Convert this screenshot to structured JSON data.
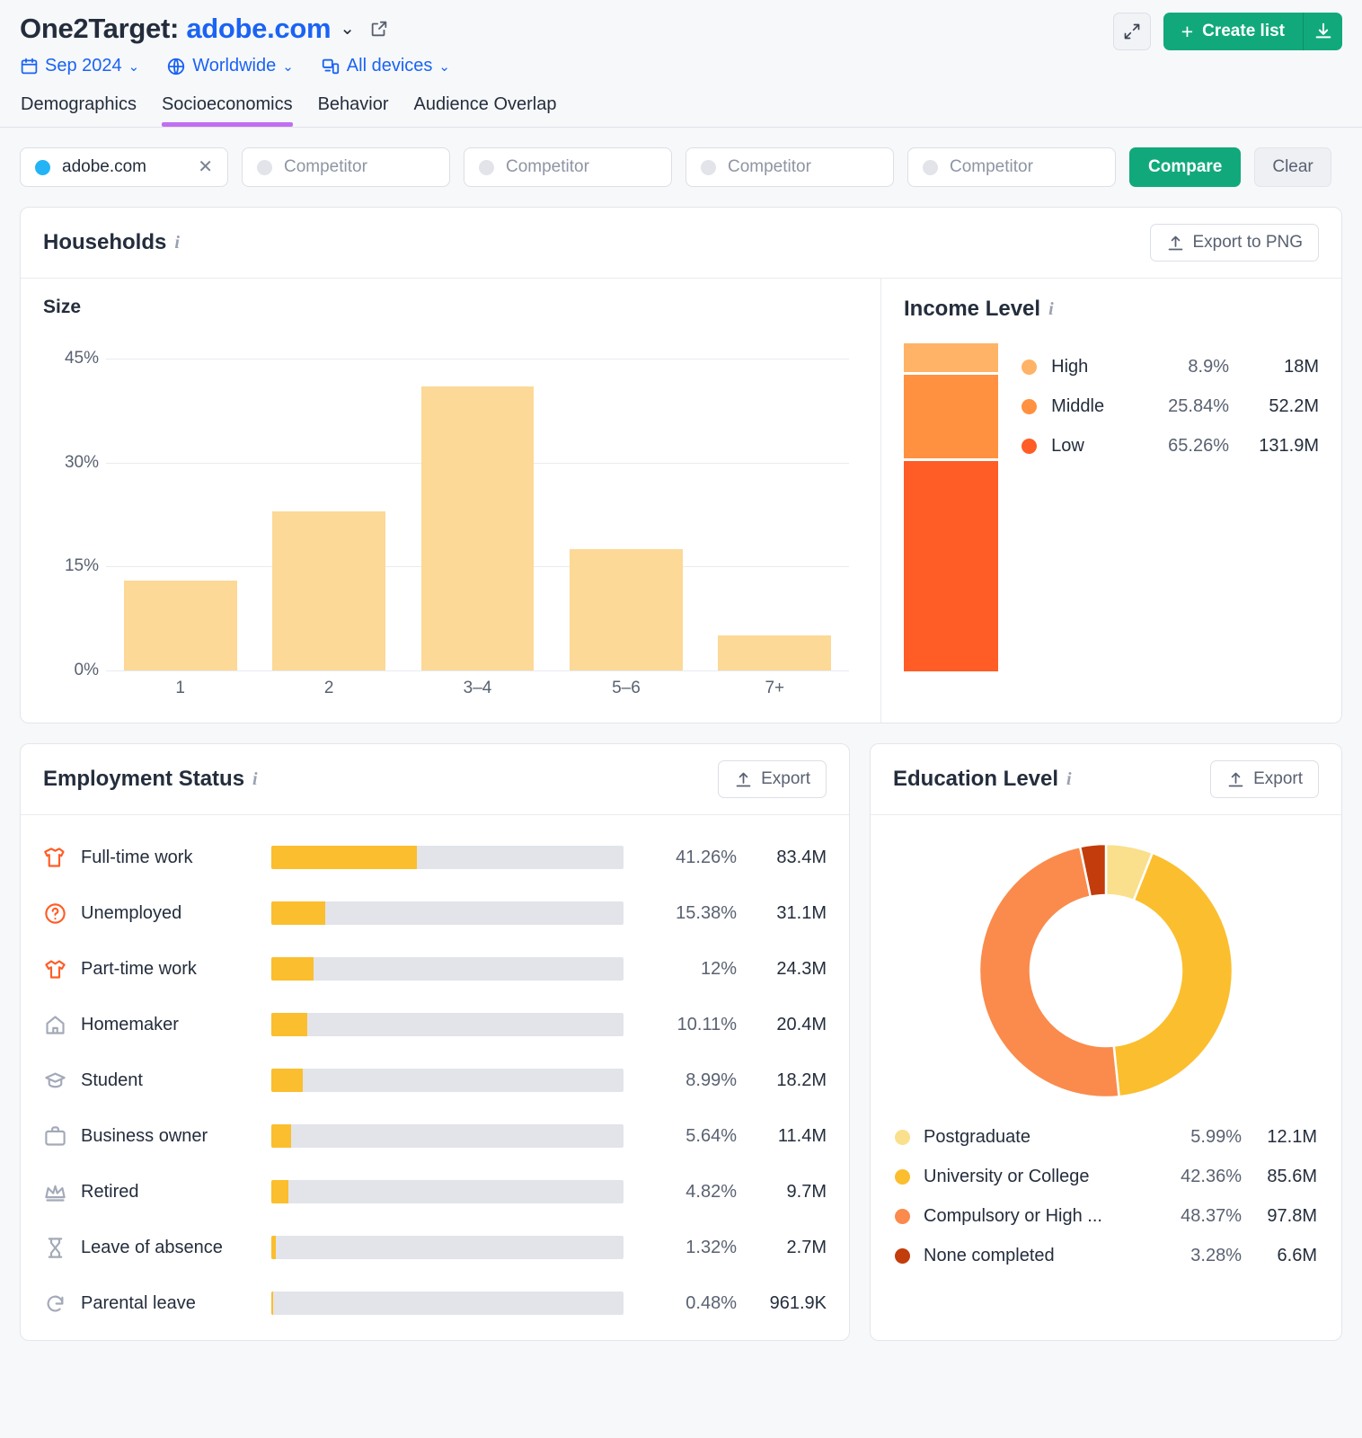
{
  "header": {
    "title_prefix": "One2Target:",
    "domain": "adobe.com",
    "caret": "⌄",
    "expand_icon": "expand-icon",
    "create_list_label": "Create list",
    "create_plus": "+",
    "download_icon": "download-icon",
    "filters": [
      {
        "label": "Sep 2024",
        "icon": "calendar-icon",
        "caret": "⌄"
      },
      {
        "label": "Worldwide",
        "icon": "globe-icon",
        "caret": "⌄"
      },
      {
        "label": "All devices",
        "icon": "devices-icon",
        "caret": "⌄"
      }
    ],
    "tabs": [
      {
        "label": "Demographics",
        "active": false
      },
      {
        "label": "Socioeconomics",
        "active": true
      },
      {
        "label": "Behavior",
        "active": false
      },
      {
        "label": "Audience Overlap",
        "active": false
      }
    ],
    "active_tab_color": "#c06ff2"
  },
  "competitors": {
    "main": {
      "label": "adobe.com",
      "dot_color": "#24b3f5",
      "remove": "✕"
    },
    "placeholders": [
      "Competitor",
      "Competitor",
      "Competitor",
      "Competitor"
    ],
    "compare_label": "Compare",
    "clear_label": "Clear"
  },
  "households": {
    "title": "Households",
    "info": "i",
    "export_label": "Export to PNG",
    "size_title": "Size",
    "income_title": "Income Level",
    "income_info": "i"
  },
  "employment": {
    "title": "Employment Status",
    "info": "i",
    "export_label": "Export"
  },
  "education": {
    "title": "Education Level",
    "info": "i",
    "export_label": "Export"
  },
  "chart_data": [
    {
      "type": "bar",
      "title": "Size",
      "categories": [
        "1",
        "2",
        "3–4",
        "5–6",
        "7+"
      ],
      "values": [
        13.0,
        23.0,
        41.0,
        17.5,
        5.0
      ],
      "ytick_labels": [
        "0%",
        "15%",
        "30%",
        "45%"
      ],
      "yticks": [
        0,
        15,
        30,
        45
      ],
      "ylim": [
        0,
        48
      ],
      "xlabel": "",
      "ylabel": "",
      "grid": true,
      "bar_color": "#fcd997"
    },
    {
      "type": "bar",
      "title": "Income Level",
      "orientation": "stacked-vertical",
      "categories": [
        "High",
        "Middle",
        "Low"
      ],
      "values": [
        8.9,
        25.84,
        65.26
      ],
      "value_labels": [
        "8.9%",
        "25.84%",
        "65.26%"
      ],
      "counts": [
        "18M",
        "52.2M",
        "131.9M"
      ],
      "colors": [
        "#ffb366",
        "#ff9140",
        "#ff5c26"
      ],
      "legend": "right"
    },
    {
      "type": "bar",
      "title": "Employment Status",
      "orientation": "horizontal",
      "categories": [
        "Full-time work",
        "Unemployed",
        "Part-time work",
        "Homemaker",
        "Student",
        "Business owner",
        "Retired",
        "Leave of absence",
        "Parental leave"
      ],
      "values": [
        41.26,
        15.38,
        12,
        10.11,
        8.99,
        5.64,
        4.82,
        1.32,
        0.48
      ],
      "value_labels": [
        "41.26%",
        "15.38%",
        "12%",
        "10.11%",
        "8.99%",
        "5.64%",
        "4.82%",
        "1.32%",
        "0.48%"
      ],
      "counts": [
        "83.4M",
        "31.1M",
        "24.3M",
        "20.4M",
        "18.2M",
        "11.4M",
        "9.7M",
        "2.7M",
        "961.9K"
      ],
      "icons": [
        "shirt-icon",
        "question-circle-icon",
        "tshirt-icon",
        "house-icon",
        "graduation-cap-icon",
        "briefcase-icon",
        "crown-icon",
        "hourglass-icon",
        "parental-leave-icon"
      ],
      "icon_colors": [
        "#ff5c26",
        "#ff5c26",
        "#ff5c26",
        "#a3a9b8",
        "#a3a9b8",
        "#a3a9b8",
        "#a3a9b8",
        "#a3a9b8",
        "#a3a9b8"
      ],
      "bar_color": "#fbbe2e",
      "track_color": "#e2e4ea",
      "max": 100
    },
    {
      "type": "pie",
      "title": "Education Level",
      "variant": "donut",
      "labels": [
        "Postgraduate",
        "University or College",
        "Compulsory or High ...",
        "None completed"
      ],
      "values": [
        5.99,
        42.36,
        48.37,
        3.28
      ],
      "value_labels": [
        "5.99%",
        "42.36%",
        "48.37%",
        "3.28%"
      ],
      "counts": [
        "12.1M",
        "85.6M",
        "97.8M",
        "6.6M"
      ],
      "colors": [
        "#fae08c",
        "#fbbe2e",
        "#fa8b4c",
        "#c33c0c"
      ],
      "legend": "bottom"
    }
  ]
}
